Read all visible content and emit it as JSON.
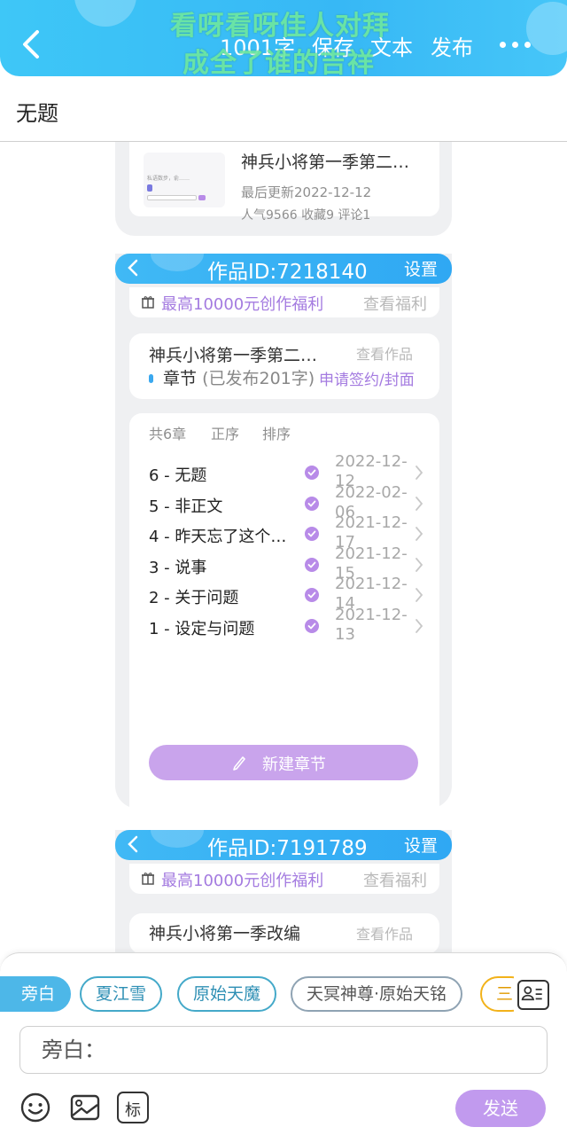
{
  "header": {
    "word_count": "1001字",
    "save_label": "保存",
    "text_label": "文本",
    "publish_label": "发布",
    "overlay_line1": "看呀看呀佳人对拜",
    "overlay_line2": "成全了谁的吉祥"
  },
  "title": "无题",
  "work_top": {
    "thumb_text": "私语数步，俞……",
    "title": "神兵小将第一季第二…",
    "updated": "最后更新2022-12-12",
    "stats": "人气9566   收藏9   评论1"
  },
  "work1": {
    "id_label": "作品ID:7218140",
    "settings_label": "设置",
    "benefit_label": "最高10000元创作福利",
    "benefit_link": "查看福利",
    "name": "神兵小将第一季第二…",
    "view_label": "查看作品",
    "chapter_label": "章节",
    "chapter_status": "(已发布201字)",
    "sign_label": "申请签约/封面",
    "chapter_count": "共6章",
    "order_label": "正序",
    "sort_label": "排序",
    "chapters": [
      {
        "name": "6 - 无题",
        "date": "2022-12-12"
      },
      {
        "name": "5 - 非正文",
        "date": "2022-02-06"
      },
      {
        "name": "4 - 昨天忘了这个…",
        "date": "2021-12-17"
      },
      {
        "name": "3 - 说事",
        "date": "2021-12-15"
      },
      {
        "name": "2 - 关于问题",
        "date": "2021-12-14"
      },
      {
        "name": "1 - 设定与问题",
        "date": "2021-12-13"
      }
    ],
    "new_chapter_label": "新建章节"
  },
  "work2": {
    "id_label": "作品ID:7191789",
    "settings_label": "设置",
    "benefit_label": "最高10000元创作福利",
    "benefit_link": "查看福利",
    "name": "神兵小将第一季改编",
    "view_label": "查看作品"
  },
  "composer": {
    "roles": [
      "旁白",
      "夏江雪",
      "原始天魔",
      "天冥神尊·原始天铭",
      "三"
    ],
    "input_placeholder": "旁白：",
    "send_label": "发送",
    "tag_tool_label": "标"
  },
  "icons": [
    "back-icon",
    "more-icon",
    "gift-icon",
    "check-icon",
    "chevron-right-icon",
    "pencil-icon",
    "contact-card-icon",
    "emoji-icon",
    "image-icon",
    "tag-icon"
  ],
  "colors": {
    "header_blue": "#37b8f5",
    "accent_purple": "#a47be0",
    "button_purple": "#c19aee",
    "chip_blue": "#44a9c9"
  }
}
